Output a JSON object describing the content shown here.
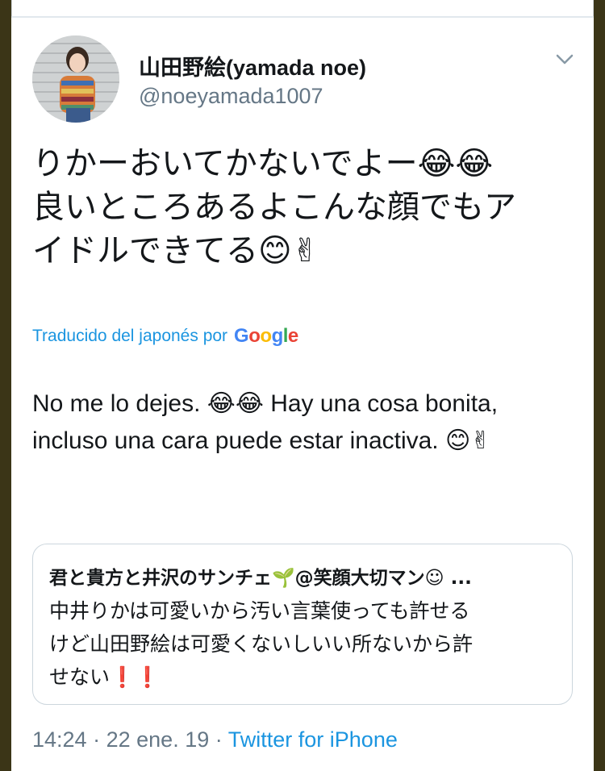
{
  "tweet": {
    "display_name": "山田野絵(yamada noe)",
    "handle": "@noeyamada1007",
    "text": "りかーおいてかないでよー😂😂\n良いところあるよこんな顔でもア\nイドルできてる😊✌",
    "translated_label": "Traducido del japonés por",
    "translator": [
      "G",
      "o",
      "o",
      "g",
      "l",
      "e"
    ],
    "translation": "No me lo dejes. 😂😂 Hay una cosa bonita, incluso una cara puede estar inactiva. 😊✌",
    "time": "14:24",
    "date": "22 ene. 19",
    "source": "Twitter for iPhone",
    "separator": "·"
  },
  "quoted_tweet": {
    "author": "君と貴方と井沢のサンチェ🌱@笑顔大切マン☺ ...",
    "text": "中井りかは可愛いから汚い言葉使っても許せる\nけど山田野絵は可愛くないしいい所ないから許\nせない❗❗"
  },
  "icons": {
    "menu": "chevron-down-icon",
    "avatar": "profile-photo"
  },
  "colors": {
    "link_blue": "#1b95e0",
    "secondary_text": "#657786",
    "border": "#ccd6dd",
    "background_outer": "#3b3517"
  }
}
